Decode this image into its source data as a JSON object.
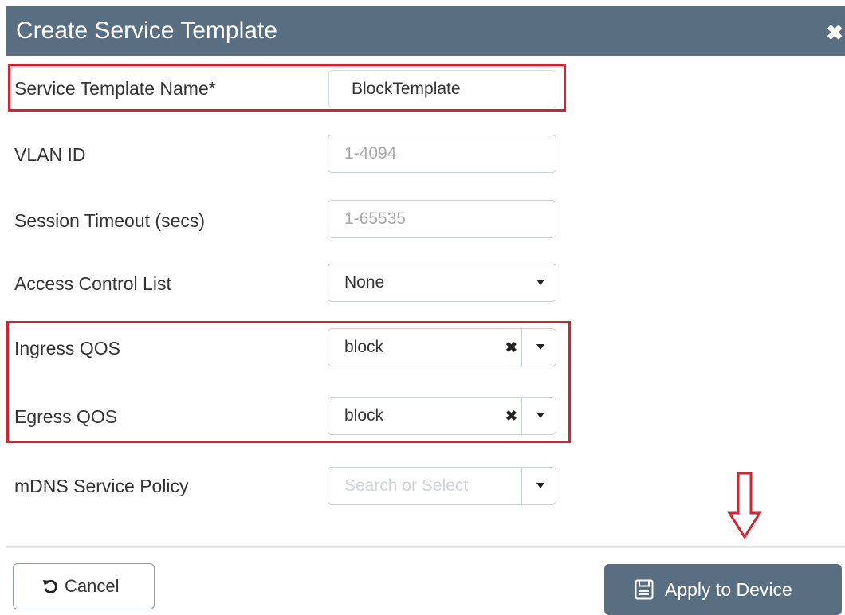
{
  "dialog": {
    "title": "Create Service Template",
    "close_glyph": "✖"
  },
  "form": {
    "service_template_name": {
      "label": "Service Template Name*",
      "value": "BlockTemplate"
    },
    "vlan_id": {
      "label": "VLAN ID",
      "placeholder": "1-4094"
    },
    "session_timeout": {
      "label": "Session Timeout (secs)",
      "placeholder": "1-65535"
    },
    "access_control_list": {
      "label": "Access Control List",
      "value": "None"
    },
    "ingress_qos": {
      "label": "Ingress QOS",
      "value": "block",
      "clear_glyph": "✖"
    },
    "egress_qos": {
      "label": "Egress QOS",
      "value": "block",
      "clear_glyph": "✖"
    },
    "mdns_service_policy": {
      "label": "mDNS Service Policy",
      "placeholder": "Search or Select"
    }
  },
  "footer": {
    "cancel_label": "Cancel",
    "apply_label": "Apply to Device"
  },
  "icons": {
    "close": "close-icon",
    "undo": "undo-icon",
    "save": "save-icon",
    "caret": "chevron-down-icon",
    "clear": "clear-icon",
    "annotation_arrow": "down-arrow-icon"
  },
  "colors": {
    "titlebar": "#596e80",
    "highlight": "#e01d2a",
    "apply_button": "#596e80"
  }
}
